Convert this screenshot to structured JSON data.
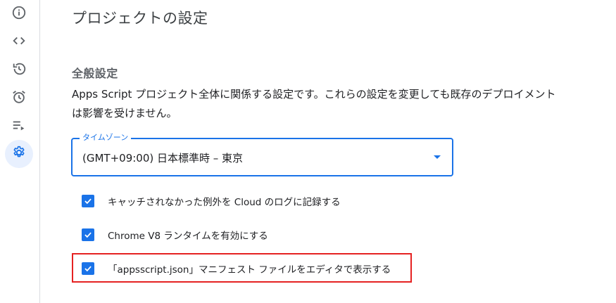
{
  "sidebar": {
    "items": [
      {
        "name": "overview",
        "icon": "info-icon"
      },
      {
        "name": "editor",
        "icon": "code-icon"
      },
      {
        "name": "executions",
        "icon": "history-icon"
      },
      {
        "name": "triggers",
        "icon": "alarm-icon"
      },
      {
        "name": "queue",
        "icon": "playlist-icon"
      },
      {
        "name": "settings",
        "icon": "gear-icon",
        "active": true
      }
    ]
  },
  "page": {
    "title": "プロジェクトの設定"
  },
  "general": {
    "section_title": "全般設定",
    "description": "Apps Script プロジェクト全体に関係する設定です。これらの設定を変更しても既存のデプロイメントは影響を受けません。",
    "timezone": {
      "label": "タイムゾーン",
      "value": "(GMT+09:00) 日本標準時 – 東京"
    },
    "options": [
      {
        "label": "キャッチされなかった例外を Cloud のログに記録する",
        "checked": true
      },
      {
        "label": "Chrome V8 ランタイムを有効にする",
        "checked": true
      },
      {
        "label": "「appsscript.json」マニフェスト ファイルをエディタで表示する",
        "checked": true
      }
    ]
  },
  "colors": {
    "accent": "#1a73e8",
    "highlight_border": "#e52222",
    "active_nav_bg": "#e8f0fe"
  }
}
